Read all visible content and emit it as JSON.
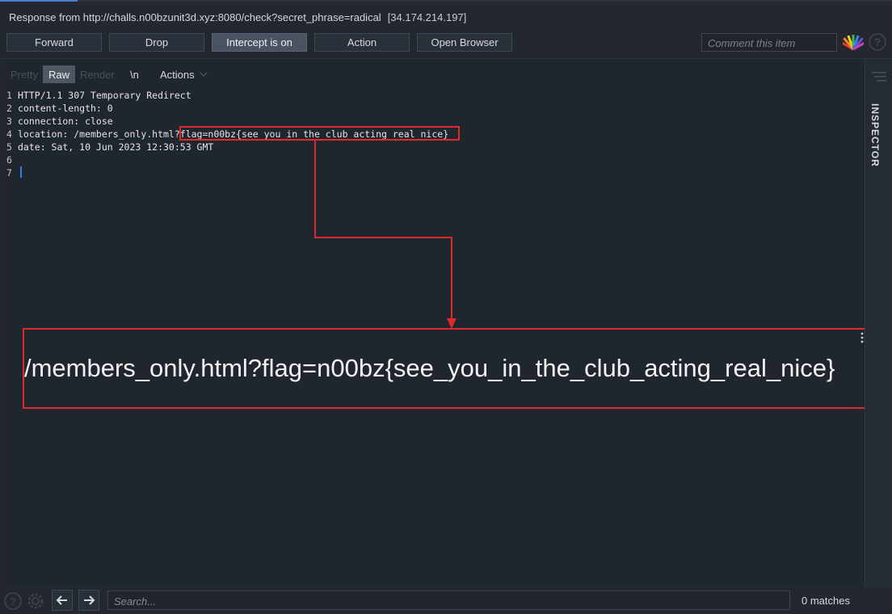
{
  "header": {
    "title": "Response from http://challs.n00bzunit3d.xyz:8080/check?secret_phrase=radical",
    "ip": "[34.174.214.197]"
  },
  "toolbar": {
    "forward": "Forward",
    "drop": "Drop",
    "intercept": "Intercept is on",
    "action": "Action",
    "open_browser": "Open Browser",
    "comment_placeholder": "Comment this item"
  },
  "tabs": {
    "pretty": "Pretty",
    "raw": "Raw",
    "render": "Render",
    "newline": "\\n",
    "actions": "Actions"
  },
  "code": {
    "lines": [
      {
        "n": "1",
        "text": "HTTP/1.1 307 Temporary Redirect"
      },
      {
        "n": "2",
        "text": "content-length: 0"
      },
      {
        "n": "3",
        "text": "connection: close"
      },
      {
        "n": "4",
        "text": "location: /members_only.html?flag=n00bz{see_you_in_the_club_acting_real_nice}"
      },
      {
        "n": "5",
        "text": "date: Sat, 10 Jun 2023 12:30:53 GMT"
      },
      {
        "n": "6",
        "text": ""
      },
      {
        "n": "7",
        "text": ""
      }
    ]
  },
  "annotation": {
    "zoom_text": "/members_only.html?flag=n00bz{see_you_in_the_club_acting_real_nice}",
    "highlight_color": "#e0282d"
  },
  "sidebar": {
    "inspector": "INSPECTOR"
  },
  "footer": {
    "search_placeholder": "Search...",
    "matches": "0 matches"
  },
  "icons": [
    "fan-icon",
    "help-icon",
    "settings-icon",
    "arrow-left-icon",
    "arrow-right-icon",
    "kebab-icon",
    "list-icon"
  ]
}
